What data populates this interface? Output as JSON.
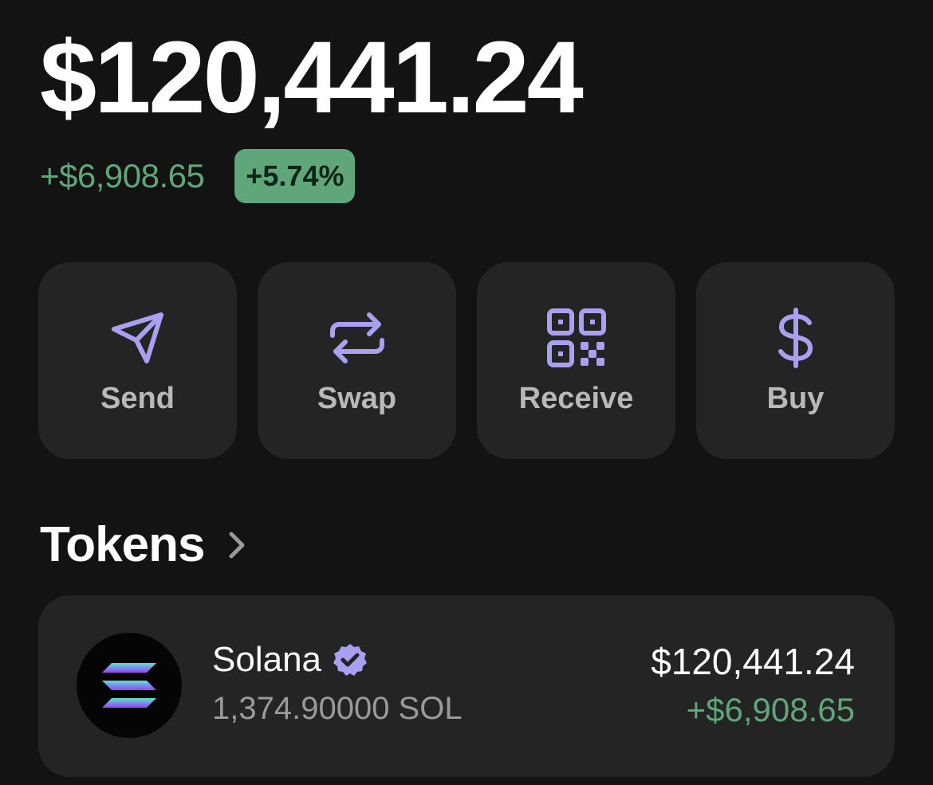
{
  "balance": {
    "total": "$120,441.24",
    "change_amount": "+$6,908.65",
    "change_percent": "+5.74%"
  },
  "actions": [
    {
      "label": "Send",
      "icon": "send-icon"
    },
    {
      "label": "Swap",
      "icon": "swap-icon"
    },
    {
      "label": "Receive",
      "icon": "qr-code-icon"
    },
    {
      "label": "Buy",
      "icon": "dollar-icon"
    }
  ],
  "tokens_section": {
    "title": "Tokens",
    "chevron_icon": "chevron-right-icon"
  },
  "tokens": [
    {
      "name": "Solana",
      "verified": true,
      "amount": "1,374.90000 SOL",
      "value": "$120,441.24",
      "change": "+$6,908.65"
    }
  ],
  "colors": {
    "background": "#131313",
    "card": "#242424",
    "accent": "#ab9ff2",
    "positive": "#5fa77a"
  }
}
